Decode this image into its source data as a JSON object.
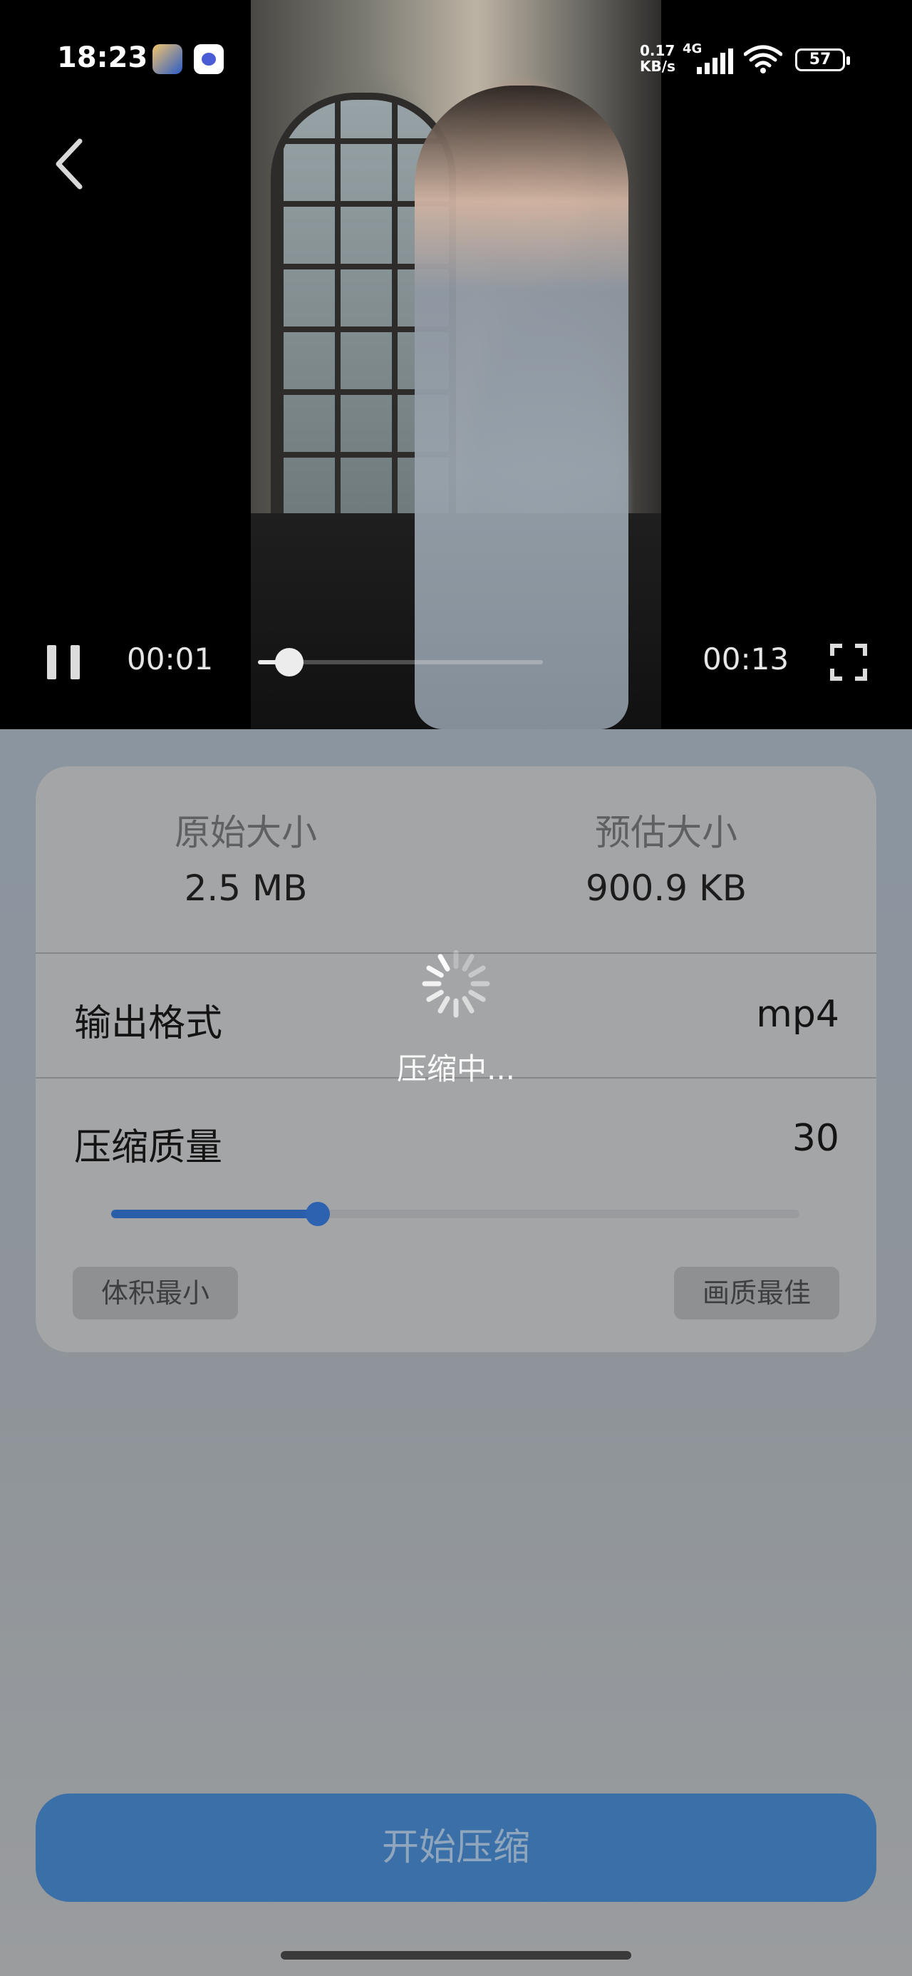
{
  "status_bar": {
    "time": "18:23",
    "net_speed_value": "0.17",
    "net_speed_unit": "KB/s",
    "net_type": "4G",
    "battery": "57"
  },
  "player": {
    "current_time": "00:01",
    "total_time": "00:13",
    "progress": 0.11
  },
  "compress": {
    "original_label": "原始大小",
    "original_value": "2.5 MB",
    "estimated_label": "预估大小",
    "estimated_value": "900.9 KB",
    "format_label": "输出格式",
    "format_value": "mp4",
    "quality_label": "压缩质量",
    "quality_value": "30",
    "quality_fraction": 0.3,
    "min_size_label": "体积最小",
    "best_quality_label": "画质最佳"
  },
  "loading": {
    "text": "压缩中..."
  },
  "actions": {
    "start_label": "开始压缩"
  },
  "colors": {
    "accent": "#2d62b0",
    "button": "#3a6fa8"
  }
}
